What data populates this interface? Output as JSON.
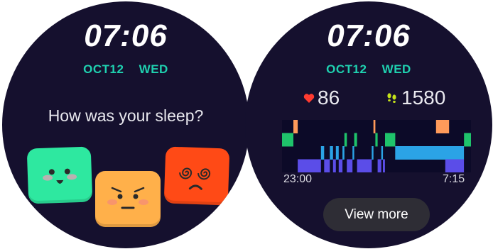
{
  "left_screen": {
    "time": "07:06",
    "date": "OCT12",
    "weekday": "WED",
    "prompt": "How was your sleep?",
    "moods": [
      {
        "name": "happy",
        "color": "#2ee8a0"
      },
      {
        "name": "meh",
        "color": "#ffb04a"
      },
      {
        "name": "dizzy",
        "color": "#ff4a16"
      }
    ]
  },
  "right_screen": {
    "time": "07:06",
    "date": "OCT12",
    "weekday": "WED",
    "heart_rate": "86",
    "heart_icon": "heart-icon",
    "steps": "1580",
    "steps_icon": "footsteps-icon",
    "sleep_start": "23:00",
    "sleep_end": "7:15",
    "view_more_label": "View more"
  },
  "colors": {
    "background": "#15102e",
    "accent": "#1fd1b0",
    "awake": "#ff9a5a",
    "rem": "#1fc36b",
    "light": "#2ba3e6",
    "deep": "#5b4de8"
  },
  "chart_data": {
    "type": "table",
    "title": "",
    "start": "23:00",
    "end": "7:15",
    "stages": [
      "awake",
      "rem",
      "light",
      "deep"
    ],
    "segments": [
      {
        "stage": "rem",
        "start": 0.0,
        "end": 0.06
      },
      {
        "stage": "awake",
        "start": 0.06,
        "end": 0.083
      },
      {
        "stage": "deep",
        "start": 0.083,
        "end": 0.206
      },
      {
        "stage": "light",
        "start": 0.206,
        "end": 0.223
      },
      {
        "stage": "deep",
        "start": 0.223,
        "end": 0.253
      },
      {
        "stage": "light",
        "start": 0.253,
        "end": 0.27
      },
      {
        "stage": "deep",
        "start": 0.27,
        "end": 0.285
      },
      {
        "stage": "light",
        "start": 0.285,
        "end": 0.3
      },
      {
        "stage": "deep",
        "start": 0.3,
        "end": 0.32
      },
      {
        "stage": "light",
        "start": 0.32,
        "end": 0.33
      },
      {
        "stage": "rem",
        "start": 0.33,
        "end": 0.343
      },
      {
        "stage": "deep",
        "start": 0.343,
        "end": 0.373
      },
      {
        "stage": "light",
        "start": 0.373,
        "end": 0.382
      },
      {
        "stage": "rem",
        "start": 0.382,
        "end": 0.397
      },
      {
        "stage": "deep",
        "start": 0.397,
        "end": 0.475
      },
      {
        "stage": "light",
        "start": 0.475,
        "end": 0.484
      },
      {
        "stage": "awake",
        "start": 0.484,
        "end": 0.494
      },
      {
        "stage": "rem",
        "start": 0.494,
        "end": 0.506
      },
      {
        "stage": "deep",
        "start": 0.506,
        "end": 0.525
      },
      {
        "stage": "light",
        "start": 0.525,
        "end": 0.534
      },
      {
        "stage": "deep",
        "start": 0.534,
        "end": 0.545
      },
      {
        "stage": "rem",
        "start": 0.545,
        "end": 0.599
      },
      {
        "stage": "light",
        "start": 0.599,
        "end": 0.963
      },
      {
        "stage": "awake",
        "start": 0.815,
        "end": 0.884
      },
      {
        "stage": "deep",
        "start": 0.864,
        "end": 0.963
      },
      {
        "stage": "rem",
        "start": 0.963,
        "end": 1.0
      }
    ]
  }
}
